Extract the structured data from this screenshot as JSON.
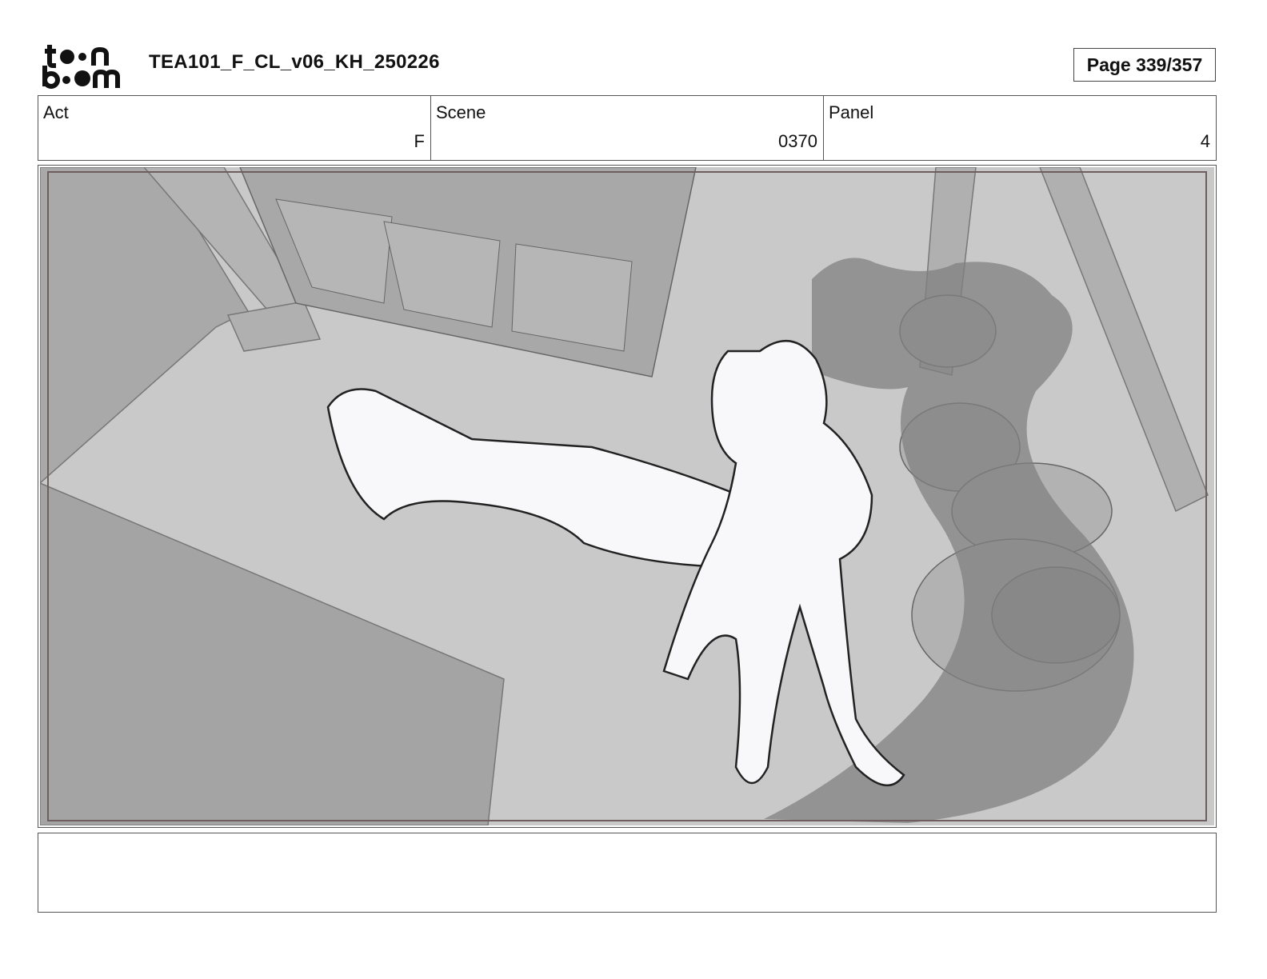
{
  "logo": {
    "line1": "toon",
    "line2": "boom"
  },
  "header": {
    "title": "TEA101_F_CL_v06_KH_250226",
    "page_label": "Page 339/357"
  },
  "fields": {
    "act": {
      "label": "Act",
      "value": "F"
    },
    "scene": {
      "label": "Scene",
      "value": "0370"
    },
    "panel": {
      "label": "Panel",
      "value": "4"
    }
  },
  "notes": {
    "text": ""
  },
  "colors": {
    "floor": "#c8c8c8",
    "shadow": "#a6a6a6",
    "smoke": "#7a7a7a",
    "panel_border": "#6e5e5e"
  }
}
